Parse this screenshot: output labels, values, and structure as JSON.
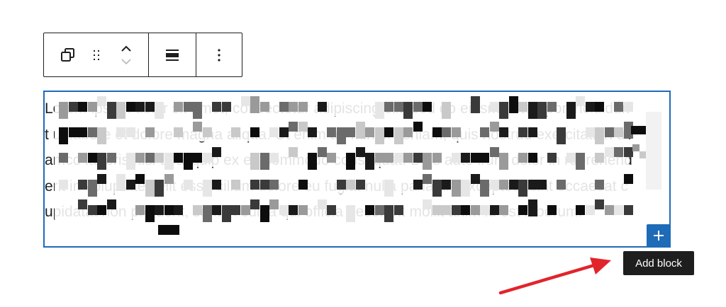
{
  "toolbar": {
    "transform_label": "Paragraph",
    "drag_label": "Drag",
    "move_up_label": "Move up",
    "move_down_label": "Move down",
    "align_label": "Align text",
    "options_label": "Options"
  },
  "paragraph": {
    "text": "Lorem ipsum dolor sit amet, consectetur adipiscing elit, sed do eiusmod tempor incididunt ut labore et dolore magna aliqua. Ut enim ad minim veniam, quis nostrud exercitation ullamco laboris nisi ut aliquip ex ea commodo consequat. Duis aute irure dolor in reprehenderit in voluptate velit esse cillum dolore eu fugiat nulla pariatur. Excepteur sint occaecat cupidatat non proident, sunt in culpa qui officia deserunt mollit anim id est laborum."
  },
  "add_block": {
    "label": "Add block",
    "tooltip": "Add block"
  },
  "colors": {
    "accent": "#1e6bb8",
    "text": "#1e1e1e",
    "arrow": "#e2242b"
  }
}
